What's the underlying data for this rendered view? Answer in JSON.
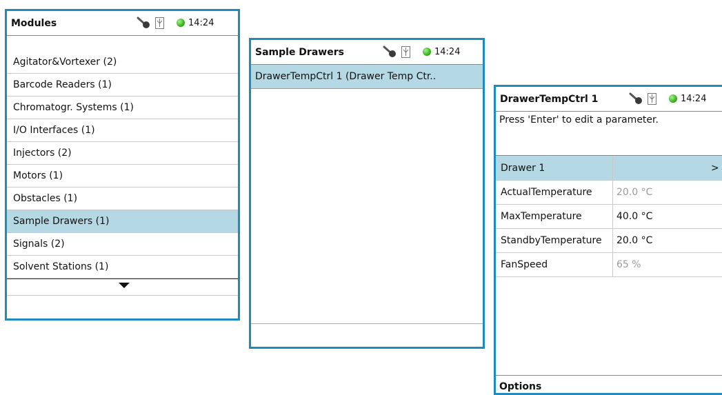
{
  "status": {
    "time": "14:24"
  },
  "modules": {
    "title": "Modules",
    "items": [
      {
        "label": "Agitator&Vortexer (2)"
      },
      {
        "label": "Barcode Readers (1)"
      },
      {
        "label": "Chromatogr. Systems (1)"
      },
      {
        "label": "I/O Interfaces (1)"
      },
      {
        "label": "Injectors (2)"
      },
      {
        "label": "Motors (1)"
      },
      {
        "label": "Obstacles (1)"
      },
      {
        "label": "Sample Drawers (1)",
        "selected": true
      },
      {
        "label": "Signals (2)"
      },
      {
        "label": "Solvent Stations (1)"
      }
    ]
  },
  "drawers": {
    "title": "Sample Drawers",
    "items": [
      {
        "label": "DrawerTempCtrl 1 (Drawer Temp Ctr..",
        "selected": true
      }
    ]
  },
  "params": {
    "title": "DrawerTempCtrl 1",
    "hint": "Press 'Enter' to edit a parameter.",
    "group": {
      "label": "Drawer 1",
      "arrow": ">"
    },
    "rows": [
      {
        "name": "ActualTemperature",
        "value": "20.0 °C",
        "readonly": true
      },
      {
        "name": "MaxTemperature",
        "value": "40.0 °C",
        "readonly": false
      },
      {
        "name": "StandbyTemperature",
        "value": "20.0 °C",
        "readonly": false
      },
      {
        "name": "FanSpeed",
        "value": "65 %",
        "readonly": true
      }
    ],
    "options_label": "Options"
  },
  "colors": {
    "frame": "#1f8bbd",
    "selected": "#b4d9e5",
    "status_dot": "#36b31b"
  },
  "icons": [
    "key-icon",
    "usb-icon",
    "status-dot-icon",
    "scroll-down-arrow-icon"
  ]
}
